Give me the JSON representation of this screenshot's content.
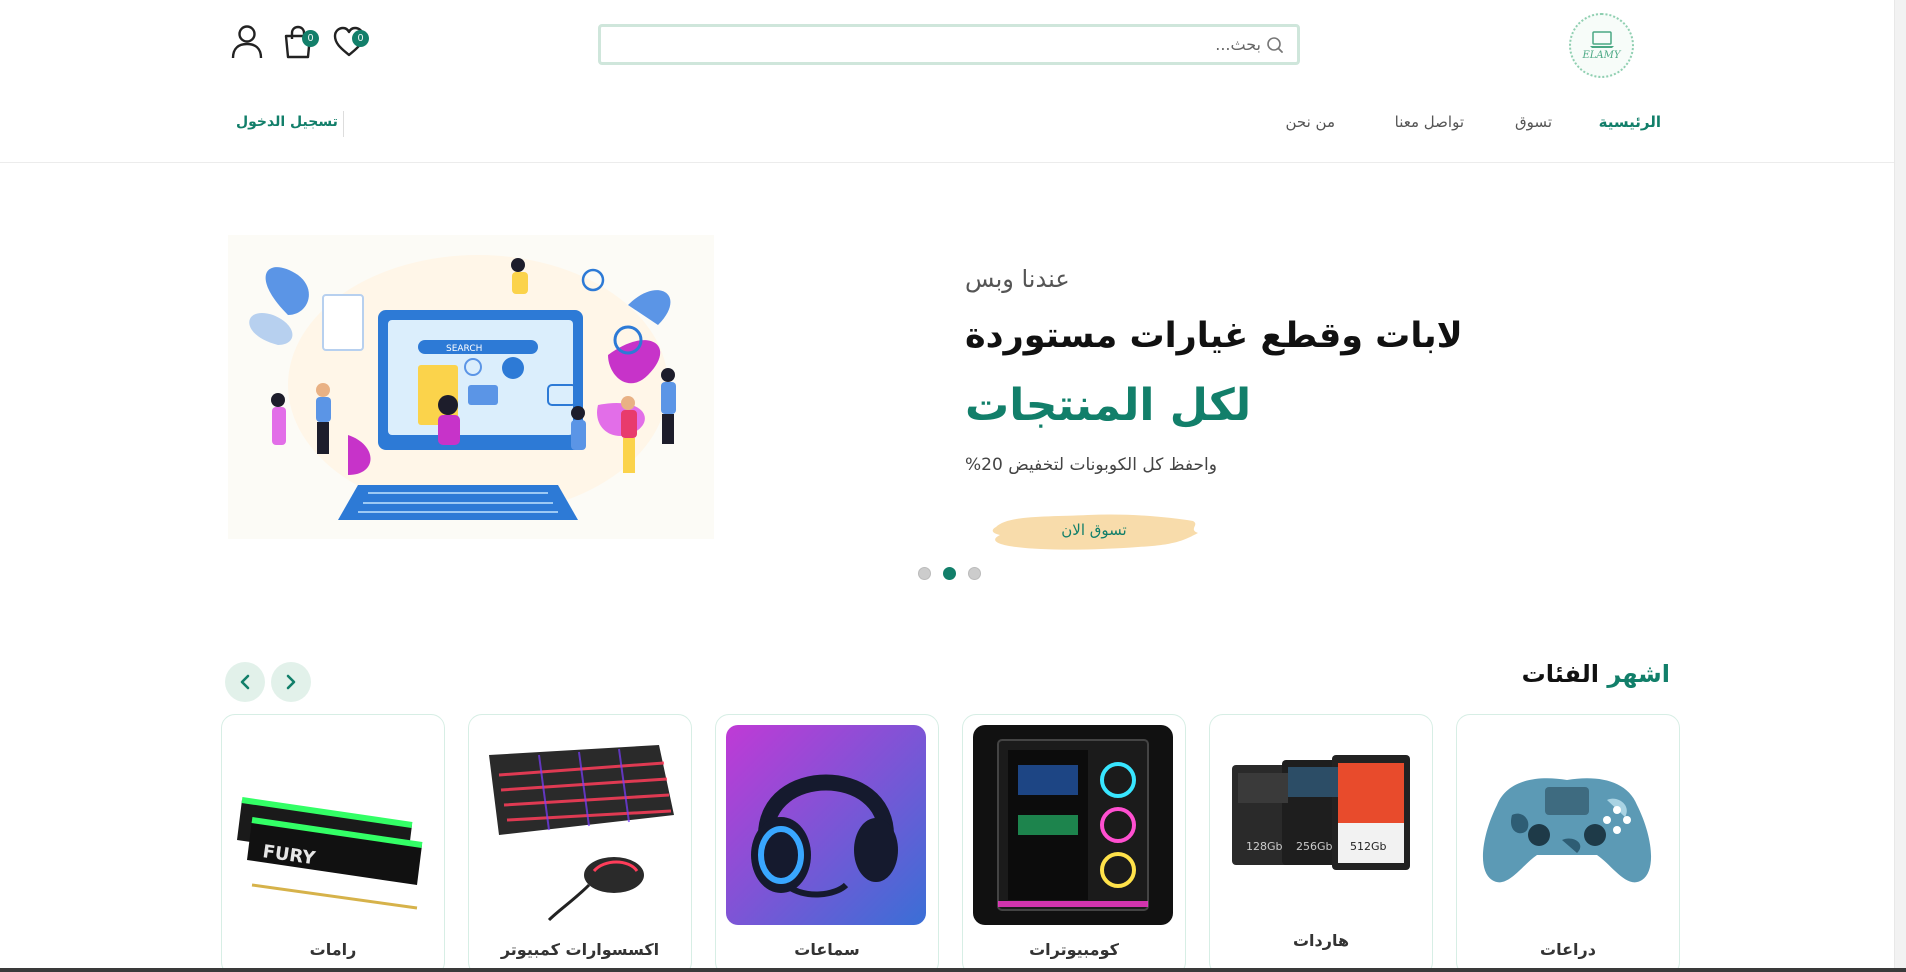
{
  "header": {
    "logo_text": "ELAMY",
    "search": {
      "placeholder": "بحث...",
      "value": ""
    },
    "wishlist_count": "0",
    "cart_count": "0",
    "icons": {
      "logo": "laptop-icon",
      "search": "search-icon",
      "wishlist": "heart-icon",
      "cart": "shopping-bag-icon",
      "account": "user-icon"
    }
  },
  "nav": {
    "items": [
      {
        "label": "الرئيسية",
        "active": true
      },
      {
        "label": "تسوق",
        "active": false
      },
      {
        "label": "تواصل معنا",
        "active": false
      },
      {
        "label": "من نحن",
        "active": false
      }
    ],
    "login_label": "تسجيل الدخول"
  },
  "hero": {
    "subtitle": "عندنا وبس",
    "title_line1": "لابات وقطع غيارات مستوردة",
    "title_line2": "لكل المنتجات",
    "description": "واحفظ كل الكوبونات لتخفيض 20%",
    "cta_label": "تسوق الان",
    "slide_count": 3,
    "active_slide": 2,
    "illustration_caption": "SEARCH"
  },
  "categories": {
    "title_accent": "اشهر",
    "title_rest": "الفئات",
    "items": [
      {
        "label": "دراعات",
        "icon": "gamepad-icon"
      },
      {
        "label": "هاردات",
        "icon": "ssd-drive-icon"
      },
      {
        "label": "كومبيوترات",
        "icon": "pc-case-icon"
      },
      {
        "label": "سماعات",
        "icon": "headset-icon"
      },
      {
        "label": "اكسسوارات كمبيوتر",
        "icon": "keyboard-mouse-icon"
      },
      {
        "label": "رامات",
        "icon": "ram-module-icon"
      }
    ],
    "product_markings": {
      "ram": "FURY",
      "ssd_sizes": [
        "128Gb",
        "256Gb",
        "512Gb"
      ]
    }
  },
  "colors": {
    "brand": "#127f6a",
    "brand_light": "#e2f1ea",
    "cta_bg": "#f8dcab",
    "search_border": "#cfe6db"
  }
}
